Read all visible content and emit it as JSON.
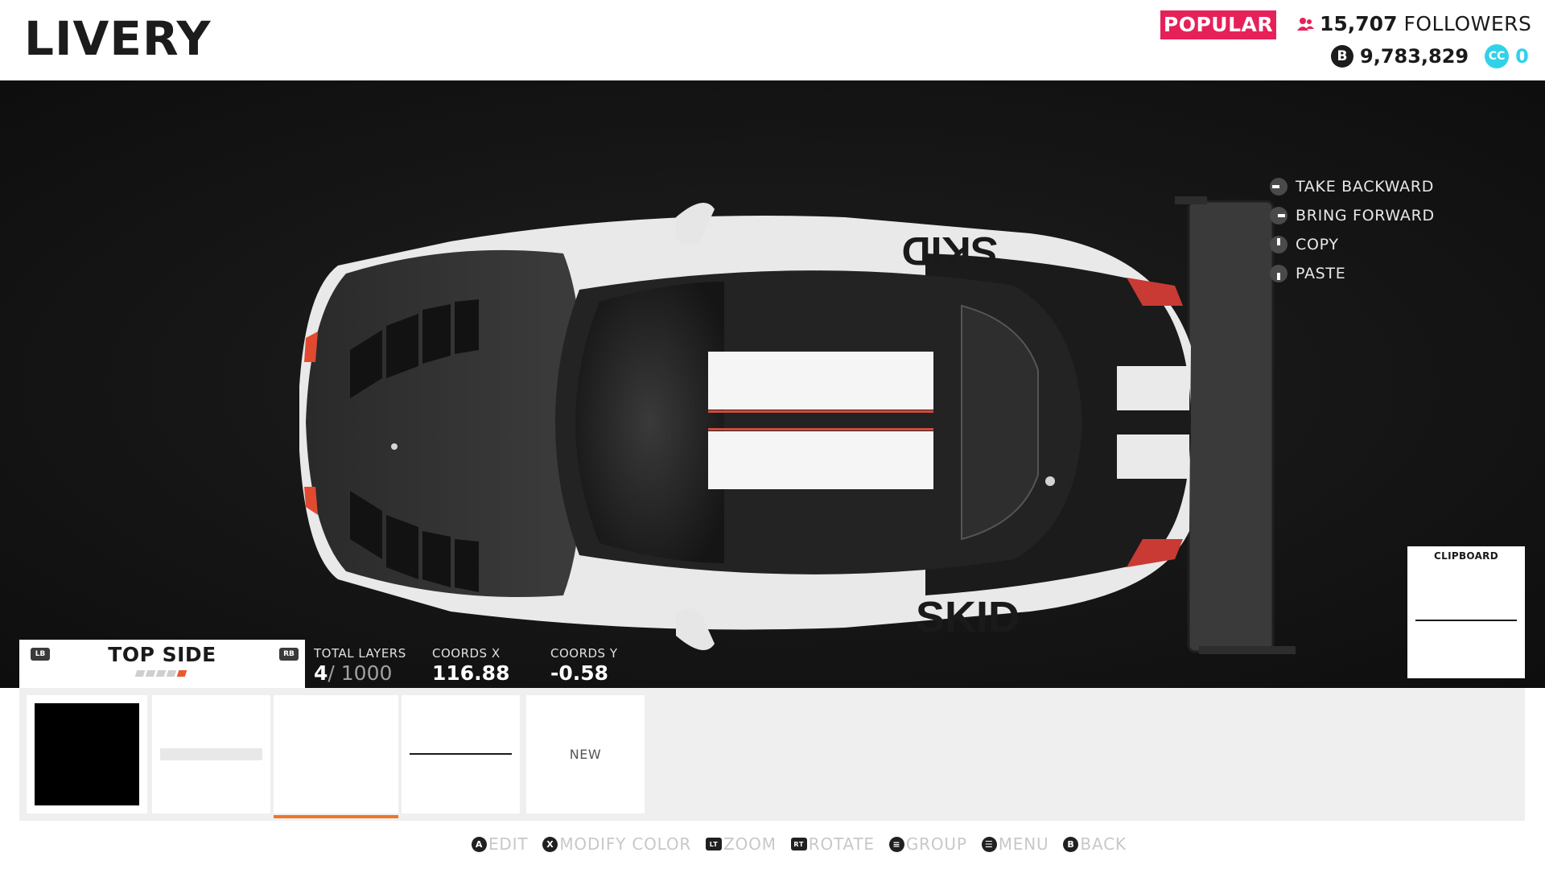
{
  "header": {
    "title": "LIVERY",
    "popular_badge": "POPULAR",
    "followers_count": "15,707",
    "followers_label": "FOLLOWERS",
    "credits": "9,783,829",
    "cc_icon": "CC",
    "cc_value": "0",
    "coin_icon": "B"
  },
  "context_menu": [
    {
      "label": "TAKE BACKWARD",
      "icon": "dpad-left-icon"
    },
    {
      "label": "BRING FORWARD",
      "icon": "dpad-right-icon"
    },
    {
      "label": "COPY",
      "icon": "dpad-up-icon"
    },
    {
      "label": "PASTE",
      "icon": "dpad-down-icon"
    }
  ],
  "clipboard": {
    "title": "CLIPBOARD"
  },
  "side_selector": {
    "lb": "LB",
    "rb": "RB",
    "title": "TOP SIDE",
    "active_dot": 4,
    "dot_count": 5
  },
  "stats": {
    "total_layers_label": "TOTAL LAYERS",
    "total_layers_value": "4",
    "total_layers_max": "/ 1000",
    "coords_x_label": "COORDS X",
    "coords_x_value": "116.88",
    "coords_y_label": "COORDS Y",
    "coords_y_value": "-0.58"
  },
  "layers": {
    "new_label": "NEW"
  },
  "car_decals": {
    "skid_top": "SKID",
    "skid_bottom": "SKID"
  },
  "hints": [
    {
      "glyph": "A",
      "label": "EDIT"
    },
    {
      "glyph": "X",
      "label": "MODIFY COLOR"
    },
    {
      "glyph": "LT",
      "label": "ZOOM"
    },
    {
      "glyph": "RT",
      "label": "ROTATE"
    },
    {
      "glyph": "≡",
      "label": "GROUP"
    },
    {
      "glyph": "☰",
      "label": "MENU"
    },
    {
      "glyph": "B",
      "label": "BACK"
    }
  ],
  "colors": {
    "accent": "#e6215a",
    "orange": "#ee7527",
    "cc": "#31d2e8"
  }
}
